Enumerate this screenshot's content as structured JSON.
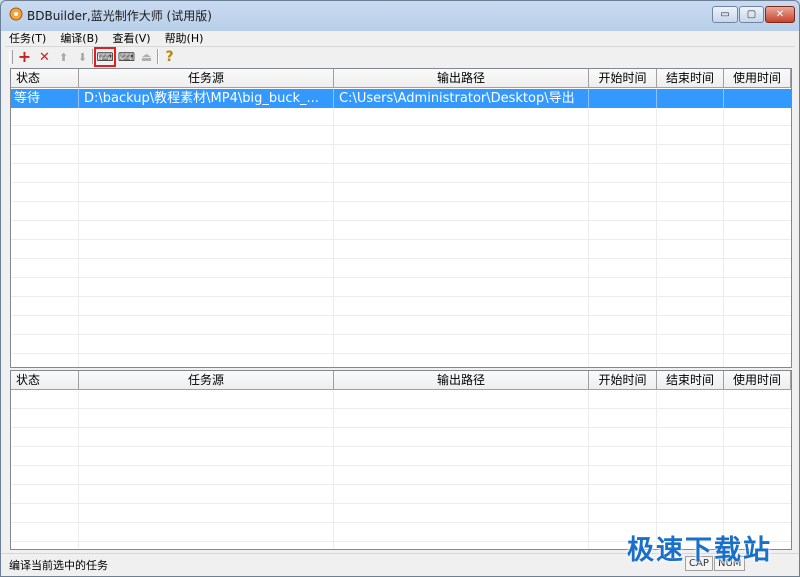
{
  "window": {
    "title": "BDBuilder,蓝光制作大师 (试用版)",
    "controls": {
      "minimize": "▭",
      "maximize": "▢",
      "close": "✕"
    }
  },
  "menu": [
    "任务(T)",
    "编译(B)",
    "查看(V)",
    "帮助(H)"
  ],
  "toolbar": {
    "buttons": [
      {
        "name": "add",
        "glyph": "+",
        "color": "#c81e1e",
        "enabled": true
      },
      {
        "name": "delete",
        "glyph": "✕",
        "color": "#c81e1e",
        "enabled": true
      },
      {
        "name": "move-up",
        "glyph": "⬆",
        "color": "#a8a8a8",
        "enabled": false
      },
      {
        "name": "move-down",
        "glyph": "⬇",
        "color": "#a8a8a8",
        "enabled": false
      },
      {
        "name": "compile-selected",
        "glyph": "⌨",
        "color": "#3a3a3a",
        "enabled": true,
        "selected": true
      },
      {
        "name": "compile-all",
        "glyph": "⌨",
        "color": "#3a3a3a",
        "enabled": true
      },
      {
        "name": "stop",
        "glyph": "⏏",
        "color": "#b0b0b0",
        "enabled": false
      },
      {
        "name": "help",
        "glyph": "?",
        "color": "#b8860b",
        "enabled": true
      }
    ]
  },
  "task_table": {
    "columns": [
      "状态",
      "任务源",
      "输出路径",
      "开始时间",
      "结束时间",
      "使用时间"
    ],
    "rows": [
      {
        "status": "等待",
        "source": "D:\\backup\\教程素材\\MP4\\big_buck_...",
        "output": "C:\\Users\\Administrator\\Desktop\\导出",
        "start": "",
        "end": "",
        "elapsed": ""
      }
    ]
  },
  "done_table": {
    "columns": [
      "状态",
      "任务源",
      "输出路径",
      "开始时间",
      "结束时间",
      "使用时间"
    ],
    "rows": []
  },
  "statusbar": {
    "text": "编译当前选中的任务",
    "indicators": [
      "CAP",
      "NUM"
    ]
  },
  "watermark": "极速下载站",
  "colors": {
    "selection": "#3399ff",
    "selected_button_outline": "#e02020",
    "watermark": "#1a6fc8"
  }
}
